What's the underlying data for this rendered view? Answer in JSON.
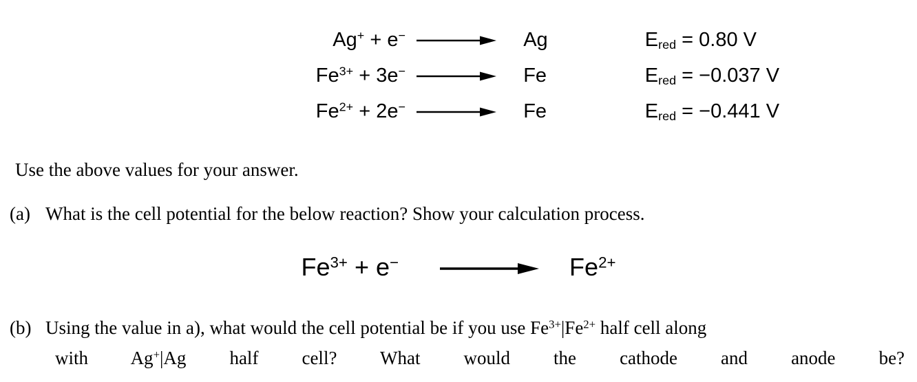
{
  "document": {
    "type": "chemistry-worksheet",
    "background_color": "#ffffff",
    "text_color": "#000000"
  },
  "half_reactions": {
    "rows": [
      {
        "reactant_species": "Ag",
        "reactant_charge": "+",
        "reactant_rest": " + e",
        "electron_charge": "−",
        "arrow": "right-arrow",
        "product": "Ag",
        "potential_symbol": "E",
        "potential_subscript": "red",
        "potential_value": "= 0.80 V"
      },
      {
        "reactant_species": "Fe",
        "reactant_charge": "3+",
        "reactant_rest": " + 3e",
        "electron_charge": "−",
        "arrow": "right-arrow",
        "product": "Fe",
        "potential_symbol": "E",
        "potential_subscript": "red",
        "potential_value": "= −0.037 V"
      },
      {
        "reactant_species": "Fe",
        "reactant_charge": "2+",
        "reactant_rest": " + 2e",
        "electron_charge": "−",
        "arrow": "right-arrow",
        "product": "Fe",
        "potential_symbol": "E",
        "potential_subscript": "red",
        "potential_value": "= −0.441 V"
      }
    ]
  },
  "intro": {
    "text": "Use the above values for your answer."
  },
  "question_a": {
    "label": "(a)",
    "text": "What is the cell potential for the below reaction? Show your calculation process.",
    "equation": {
      "reactant_species": "Fe",
      "reactant_charge": "3+",
      "reactant_rest": " + e",
      "electron_charge": "−",
      "arrow": "right-arrow",
      "product_species": "Fe",
      "product_charge": "2+"
    }
  },
  "question_b": {
    "label": "(b)",
    "line1_part1": "Using the value in a), what would the cell potential be if you use Fe",
    "line1_sup1": "3+",
    "line1_sep": "|",
    "line1_part2": "Fe",
    "line1_sup2": "2+",
    "line1_part3": " half cell along",
    "line2_word1": "with",
    "line2_ag1": "Ag",
    "line2_ag1_sup": "+",
    "line2_sep": "|",
    "line2_ag2": "Ag",
    "line2_word2": "half",
    "line2_word3": "cell?",
    "line2_word4": "What",
    "line2_word5": "would",
    "line2_word6": "the",
    "line2_word7": "cathode",
    "line2_word8": "and",
    "line2_word9": "anode",
    "line2_word10": "be?"
  }
}
